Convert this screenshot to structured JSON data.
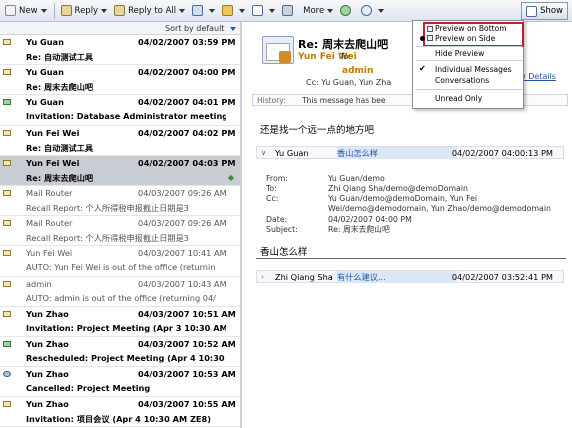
{
  "toolbar": {
    "new_label": "New",
    "reply_label": "Reply",
    "reply_all_label": "Reply to All",
    "more_label": "More",
    "show_label": "Show"
  },
  "list": {
    "sort_label": "Sort by default",
    "messages": [
      {
        "from": "Yu Guan",
        "date": "04/02/2007 03:59 PM",
        "subject": "Re: 自动测试工具",
        "read": false
      },
      {
        "from": "Yu Guan",
        "date": "04/02/2007 04:00 PM",
        "subject": "Re: 周末去爬山吧",
        "read": false
      },
      {
        "from": "Yu Guan",
        "date": "04/02/2007 04:01 PM",
        "subject": "Invitation: Database Administrator meeting (",
        "read": false
      },
      {
        "from": "Yun Fei Wei",
        "date": "04/02/2007 04:02 PM",
        "subject": "Re: 自动测试工具",
        "read": false
      },
      {
        "from": "Yun Fei Wei",
        "date": "04/02/2007 04:03 PM",
        "subject": "Re: 周末去爬山吧",
        "read": false
      },
      {
        "from": "Mail Router",
        "date": "04/03/2007 09:26 AM",
        "subject": "Recall Report: 个人所得税申报截止日期是3",
        "read": true
      },
      {
        "from": "Mail Router",
        "date": "04/03/2007 09:26 AM",
        "subject": "Recall Report: 个人所得税申报截止日期是3",
        "read": true
      },
      {
        "from": "Yun Fei Wei",
        "date": "04/03/2007 10:41 AM",
        "subject": "AUTO: Yun Fei Wei is out of the office (returnin",
        "read": true
      },
      {
        "from": "admin",
        "date": "04/03/2007 10:43 AM",
        "subject": "AUTO: admin is out of the office (returning 04/",
        "read": true
      },
      {
        "from": "Yun Zhao",
        "date": "04/03/2007 10:51 AM",
        "subject": "Invitation: Project Meeting (Apr 3 10:30 AM ZE",
        "read": false
      },
      {
        "from": "Yun Zhao",
        "date": "04/03/2007 10:52 AM",
        "subject": "Rescheduled: Project Meeting (Apr 4 10:30 A",
        "read": false
      },
      {
        "from": "Yun Zhao",
        "date": "04/03/2007 10:53 AM",
        "subject": "Cancelled: Project Meeting",
        "read": false
      },
      {
        "from": "Yun Zhao",
        "date": "04/03/2007 10:55 AM",
        "subject": "Invitation: 项目会议 (Apr 4 10:30 AM ZE8)",
        "read": false
      }
    ]
  },
  "preview": {
    "subject": "Re: 周末去爬山吧",
    "sender": "Yun Fei Wei",
    "to_label": "To:",
    "admin": "admin",
    "cc_line": "Cc:  Yu Guan, Yun Zha",
    "details_link": "iew Details",
    "history_label": "History:",
    "history_text": "This message has bee",
    "body1": "还是找一个远一点的地方吧",
    "thread1": {
      "name": "Yu Guan",
      "subject": "香山怎么样",
      "date": "04/02/2007 04:00:13 PM"
    },
    "headers": {
      "from_k": "From:",
      "from_v": "Yu Guan/demo",
      "to_k": "To:",
      "to_v": "Zhi Qiang Sha/demo@demoDomain",
      "cc_k": "Cc:",
      "cc_v": "Yu Guan/demo@demoDomain, Yun Fei Wei/demo@demodomain, Yun Zhao/demo@demodomain",
      "date_k": "Date:",
      "date_v": "04/02/2007 04:00 PM",
      "subj_k": "Subject:",
      "subj_v": "Re: 周末去爬山吧"
    },
    "body2": "香山怎么样",
    "thread2": {
      "name": "Zhi Qiang Sha",
      "subject": "有什么建议...",
      "date": "04/02/2007 03:52:41 PM"
    }
  },
  "menu": {
    "items": [
      "Preview on Bottom",
      "Preview on Side",
      "Hide Preview",
      "Individual Messages",
      "Conversations",
      "Unread Only"
    ]
  }
}
